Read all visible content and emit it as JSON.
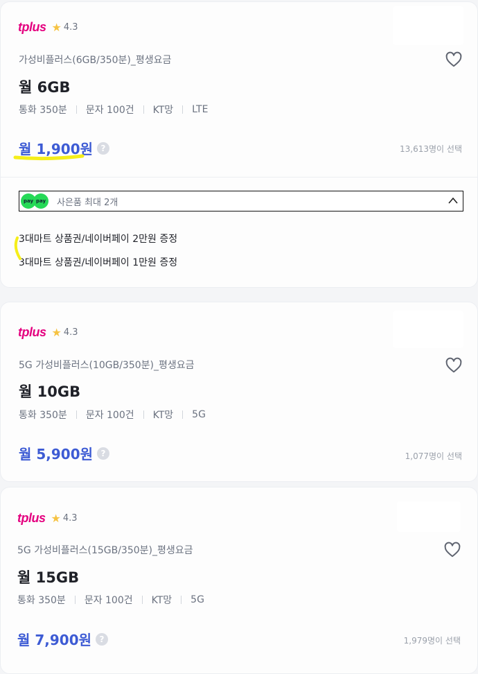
{
  "cards": [
    {
      "brand": "tplus",
      "rating": "4.3",
      "plan_name": "가성비플러스(6GB/350분)_평생요금",
      "data_title": "월 6GB",
      "specs": [
        "통화 350분",
        "문자 100건",
        "KT망",
        "LTE"
      ],
      "price": "월 1,900원",
      "selected": "13,613명이 선택",
      "gift": {
        "label": "사은품 최대 2개",
        "items": [
          "3대마트 상품권/네이버페이 2만원 증정",
          "3대마트 상품권/네이버페이 1만원 증정"
        ]
      }
    },
    {
      "brand": "tplus",
      "rating": "4.3",
      "plan_name": "5G 가성비플러스(10GB/350분)_평생요금",
      "data_title": "월 10GB",
      "specs": [
        "통화 350분",
        "문자 100건",
        "KT망",
        "5G"
      ],
      "price": "월 5,900원",
      "selected": "1,077명이 선택"
    },
    {
      "brand": "tplus",
      "rating": "4.3",
      "plan_name": "5G 가성비플러스(15GB/350분)_평생요금",
      "data_title": "월 15GB",
      "specs": [
        "통화 350분",
        "문자 100건",
        "KT망",
        "5G"
      ],
      "price": "월 7,900원",
      "selected": "1,979명이 선택"
    }
  ],
  "icons": {
    "rating": "star-icon",
    "favorite": "heart-icon",
    "help": "question-icon",
    "toggle": "chevron-up-icon",
    "gift_badge": "npay-icon"
  },
  "colors": {
    "price": "#3d5bd4",
    "brand": "#e4007f",
    "star": "#f6c343",
    "highlight": "#f5ee1a"
  }
}
